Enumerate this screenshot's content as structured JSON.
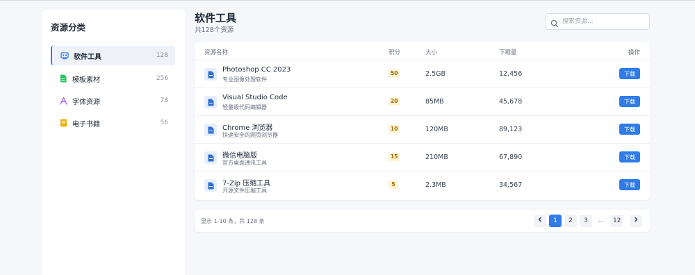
{
  "sidebar": {
    "title": "资源分类",
    "items": [
      {
        "label": "软件工具",
        "count": "128",
        "icon": "monitor-icon",
        "color": "#2f7be8",
        "active": true
      },
      {
        "label": "模板素材",
        "count": "256",
        "icon": "document-icon",
        "color": "#22c55e",
        "active": false
      },
      {
        "label": "字体资源",
        "count": "78",
        "icon": "font-icon",
        "color": "#a855f7",
        "active": false
      },
      {
        "label": "电子书籍",
        "count": "56",
        "icon": "book-icon",
        "color": "#eab308",
        "active": false
      }
    ]
  },
  "header": {
    "title": "软件工具",
    "subtitle": "共128个资源"
  },
  "search": {
    "placeholder": "搜索资源..."
  },
  "table": {
    "columns": {
      "name": "资源名称",
      "points": "积分",
      "size": "大小",
      "downloads": "下载量",
      "action": "操作"
    },
    "rows": [
      {
        "name": "Photoshop CC 2023",
        "desc": "专业图像处理软件",
        "points": "50",
        "size": "2.5GB",
        "downloads": "12,456",
        "action": "下载"
      },
      {
        "name": "Visual Studio Code",
        "desc": "轻量级代码编辑器",
        "points": "20",
        "size": "85MB",
        "downloads": "45,678",
        "action": "下载"
      },
      {
        "name": "Chrome 浏览器",
        "desc": "快速安全的网页浏览器",
        "points": "10",
        "size": "120MB",
        "downloads": "89,123",
        "action": "下载"
      },
      {
        "name": "微信电脑版",
        "desc": "官方桌面通讯工具",
        "points": "15",
        "size": "210MB",
        "downloads": "67,890",
        "action": "下载"
      },
      {
        "name": "7-Zip 压缩工具",
        "desc": "开源文件压缩工具",
        "points": "5",
        "size": "2.3MB",
        "downloads": "34,567",
        "action": "下载"
      }
    ]
  },
  "pagination": {
    "info": "显示 1-10 条，共 128 条",
    "pages": [
      "1",
      "2",
      "3",
      "...",
      "12"
    ],
    "current": "1"
  },
  "colors": {
    "accent": "#2f7be8",
    "points_bg": "#fff4d1",
    "points_text": "#a16207"
  }
}
